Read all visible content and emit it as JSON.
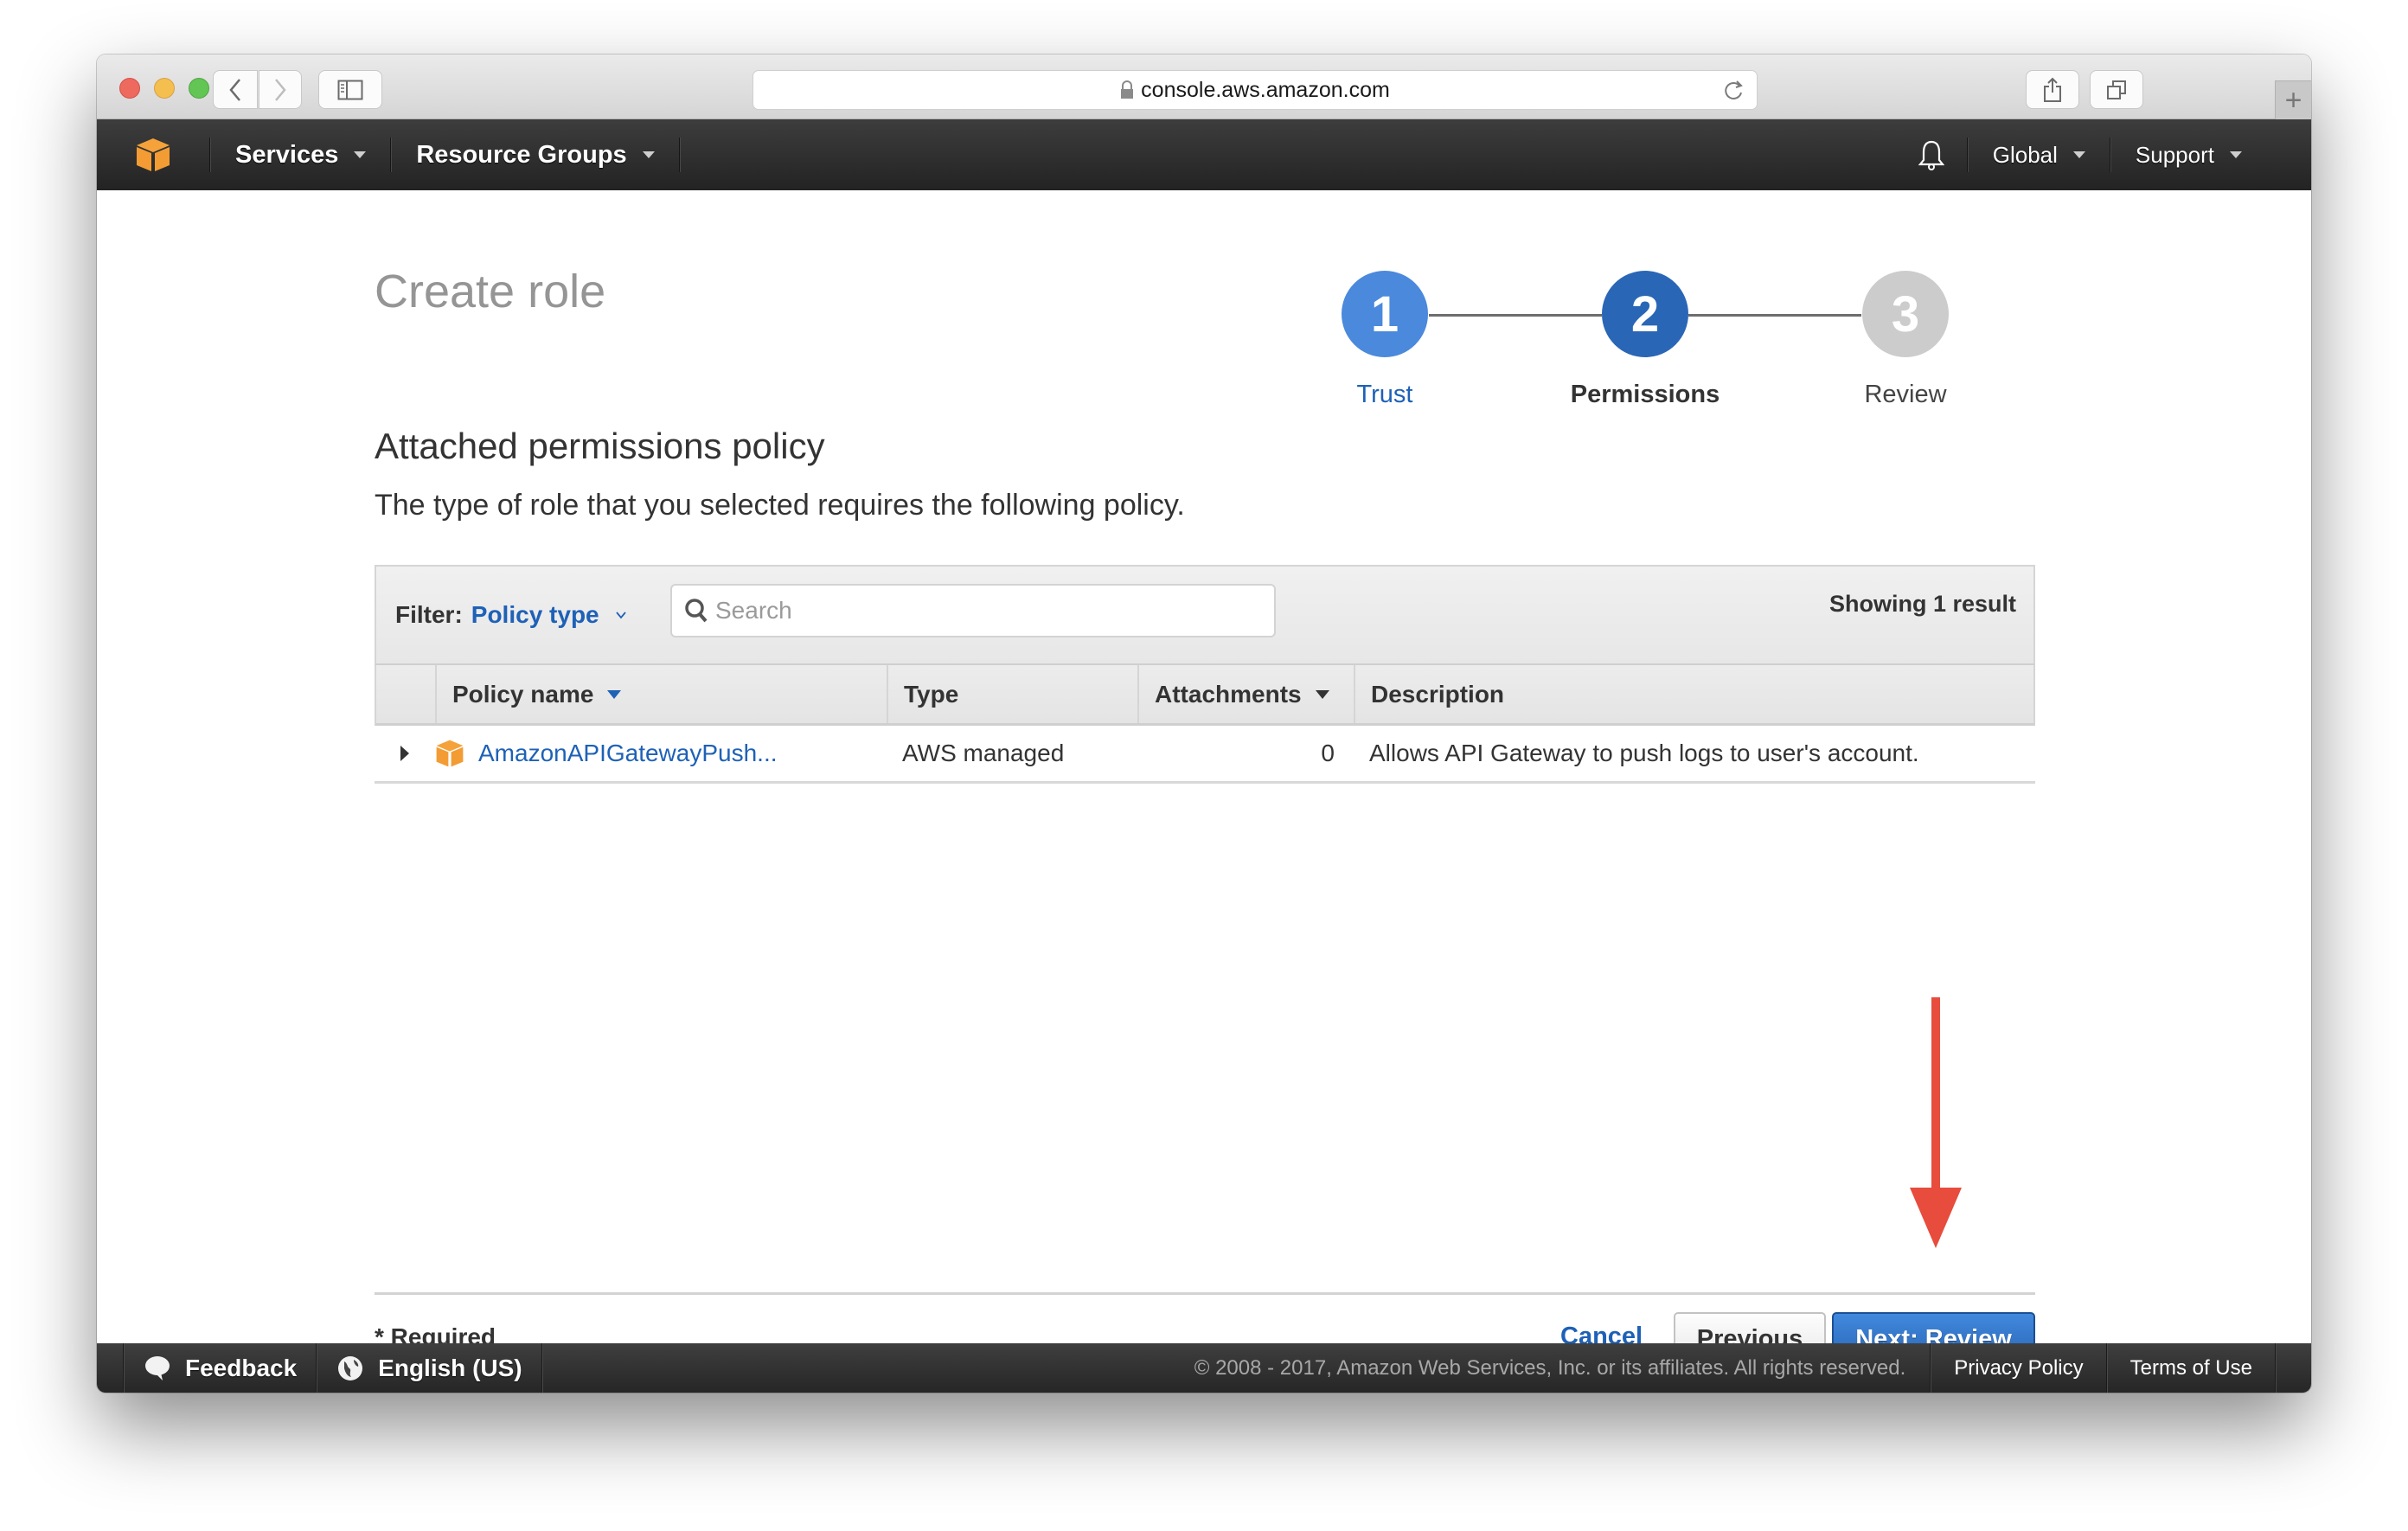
{
  "browser": {
    "url": "console.aws.amazon.com",
    "icons": {
      "back": "chevron-left-icon",
      "forward": "chevron-right-icon",
      "sidebar": "sidebar-icon",
      "lock": "lock-icon",
      "reload": "reload-icon",
      "share": "share-icon",
      "tabs": "tabs-icon",
      "new_tab": "+"
    }
  },
  "navbar": {
    "logo": "aws-cube-icon",
    "services_label": "Services",
    "resource_groups_label": "Resource Groups",
    "notifications_icon": "bell-icon",
    "region_label": "Global",
    "support_label": "Support"
  },
  "page": {
    "title": "Create role",
    "steps": [
      {
        "number": "1",
        "label": "Trust",
        "state": "completed",
        "color": "#4a89dc"
      },
      {
        "number": "2",
        "label": "Permissions",
        "state": "current",
        "color": "#2a66b6"
      },
      {
        "number": "3",
        "label": "Review",
        "state": "upcoming",
        "color": "#cccccc"
      }
    ],
    "section_title": "Attached permissions policy",
    "section_subtitle": "The type of role that you selected requires the following policy."
  },
  "table": {
    "filter_label": "Filter:",
    "filter_value": "Policy type",
    "search_placeholder": "Search",
    "search_value": "",
    "result_count": "Showing 1 result",
    "columns": [
      "",
      "Policy name",
      "Type",
      "Attachments",
      "Description"
    ],
    "rows": [
      {
        "policy_name": "AmazonAPIGatewayPush...",
        "type": "AWS managed",
        "attachments": "0",
        "description": "Allows API Gateway to push logs to user's account."
      }
    ]
  },
  "form_footer": {
    "required_note": "* Required",
    "cancel_label": "Cancel",
    "previous_label": "Previous",
    "next_label": "Next: Review"
  },
  "aws_footer": {
    "feedback_label": "Feedback",
    "language_label": "English (US)",
    "copyright": "© 2008 - 2017, Amazon Web Services, Inc. or its affiliates. All rights reserved.",
    "privacy_label": "Privacy Policy",
    "terms_label": "Terms of Use"
  },
  "colors": {
    "accent_blue": "#1e61b7",
    "primary_button": "#2f6fc3",
    "annotation_arrow": "#e74c3c",
    "aws_orange": "#f39c34"
  }
}
